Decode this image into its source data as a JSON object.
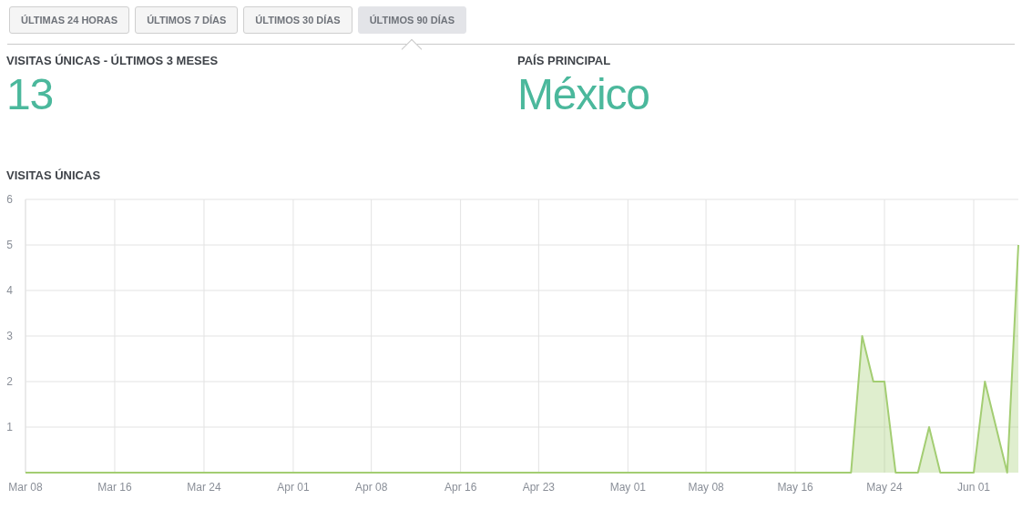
{
  "tabs": [
    {
      "label": "ÚLTIMAS 24 HORAS",
      "selected": false
    },
    {
      "label": "ÚLTIMOS 7 DÍAS",
      "selected": false
    },
    {
      "label": "ÚLTIMOS 30 DÍAS",
      "selected": false
    },
    {
      "label": "ÚLTIMOS 90 DÍAS",
      "selected": true
    }
  ],
  "stats": [
    {
      "label": "VISITAS ÚNICAS - ÚLTIMOS 3 MESES",
      "value": "13"
    },
    {
      "label": "PAÍS PRINCIPAL",
      "value": "México"
    }
  ],
  "chart": {
    "title": "VISITAS ÚNICAS",
    "chart_data": {
      "type": "area",
      "grid": true,
      "ylim": [
        0,
        6
      ],
      "yticks": [
        1,
        2,
        3,
        4,
        5,
        6
      ],
      "categories": [
        "Mar 08",
        null,
        null,
        null,
        null,
        null,
        null,
        null,
        "Mar 16",
        null,
        null,
        null,
        null,
        null,
        null,
        null,
        "Mar 24",
        null,
        null,
        null,
        null,
        null,
        null,
        null,
        "Apr 01",
        null,
        null,
        null,
        null,
        null,
        null,
        "Apr 08",
        null,
        null,
        null,
        null,
        null,
        null,
        null,
        "Apr 16",
        null,
        null,
        null,
        null,
        null,
        null,
        "Apr 23",
        null,
        null,
        null,
        null,
        null,
        null,
        null,
        "May 01",
        null,
        null,
        null,
        null,
        null,
        null,
        "May 08",
        null,
        null,
        null,
        null,
        null,
        null,
        null,
        "May 16",
        null,
        null,
        null,
        null,
        null,
        null,
        null,
        "May 24",
        null,
        null,
        null,
        null,
        null,
        null,
        null,
        "Jun 01",
        null,
        null,
        null,
        null
      ],
      "series": [
        {
          "color": "#a3cd72",
          "values": [
            0,
            0,
            0,
            0,
            0,
            0,
            0,
            0,
            0,
            0,
            0,
            0,
            0,
            0,
            0,
            0,
            0,
            0,
            0,
            0,
            0,
            0,
            0,
            0,
            0,
            0,
            0,
            0,
            0,
            0,
            0,
            0,
            0,
            0,
            0,
            0,
            0,
            0,
            0,
            0,
            0,
            0,
            0,
            0,
            0,
            0,
            0,
            0,
            0,
            0,
            0,
            0,
            0,
            0,
            0,
            0,
            0,
            0,
            0,
            0,
            0,
            0,
            0,
            0,
            0,
            0,
            0,
            0,
            0,
            0,
            0,
            0,
            0,
            0,
            0,
            3,
            2,
            2,
            0,
            0,
            0,
            1,
            0,
            0,
            0,
            0,
            2,
            1,
            0,
            5
          ]
        }
      ]
    }
  }
}
